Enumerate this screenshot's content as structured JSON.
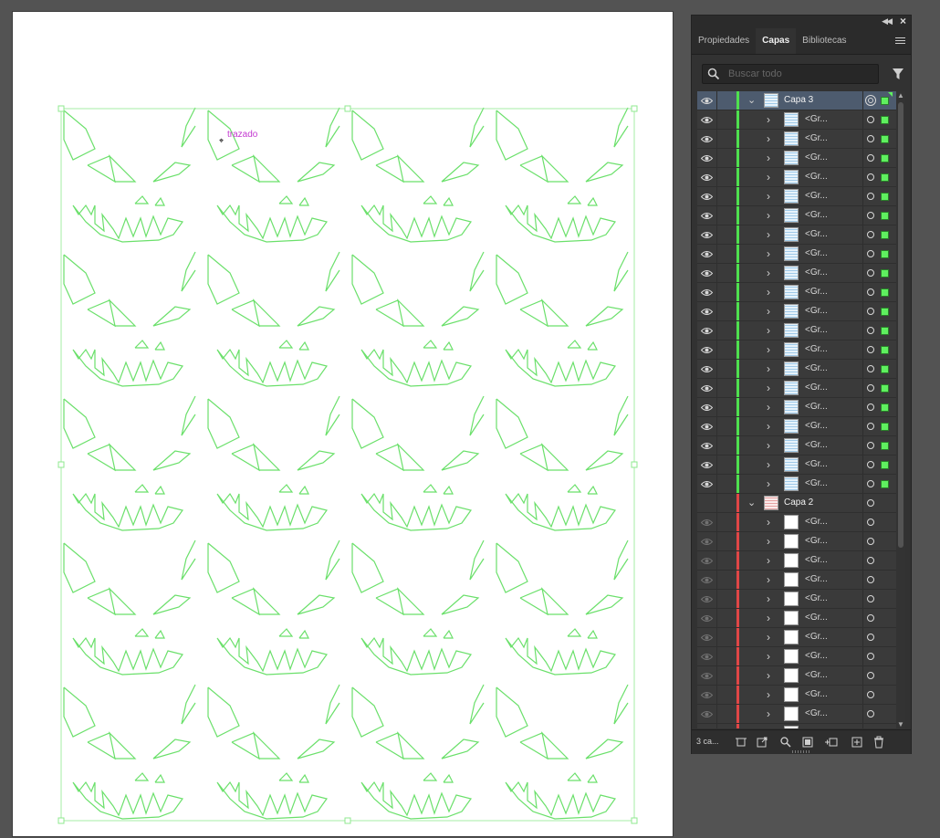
{
  "canvas": {
    "cursor_label": "trazado",
    "artwork_color": "#6be06b",
    "bbox_color": "#8fe88f"
  },
  "panel": {
    "tabs": [
      {
        "label": "Propiedades",
        "active": false
      },
      {
        "label": "Capas",
        "active": true
      },
      {
        "label": "Bibliotecas",
        "active": false
      }
    ],
    "search": {
      "placeholder": "Buscar todo"
    },
    "layers": [
      {
        "name": "Capa 3",
        "color": "#4fe04f",
        "visible": true,
        "expanded": true,
        "selected": true,
        "children": [
          "<Gr...",
          "<Gr...",
          "<Gr...",
          "<Gr...",
          "<Gr...",
          "<Gr...",
          "<Gr...",
          "<Gr...",
          "<Gr...",
          "<Gr...",
          "<Gr...",
          "<Gr...",
          "<Gr...",
          "<Gr...",
          "<Gr...",
          "<Gr...",
          "<Gr...",
          "<Gr...",
          "<Gr...",
          "<Gr..."
        ]
      },
      {
        "name": "Capa 2",
        "color": "#e04646",
        "visible": false,
        "expanded": true,
        "selected": false,
        "children": [
          "<Gr...",
          "<Gr...",
          "<Gr...",
          "<Gr...",
          "<Gr...",
          "<Gr...",
          "<Gr...",
          "<Gr...",
          "<Gr...",
          "<Gr...",
          "<Gr...",
          "<Gr..."
        ]
      }
    ],
    "footer": {
      "layer_count": "3 ca..."
    },
    "icons": {
      "eye": "eye-icon",
      "search": "search-icon",
      "filter": "filter-icon",
      "collapse": "collapse-panel-icon",
      "close": "close-icon",
      "menu": "panel-menu-icon"
    }
  }
}
